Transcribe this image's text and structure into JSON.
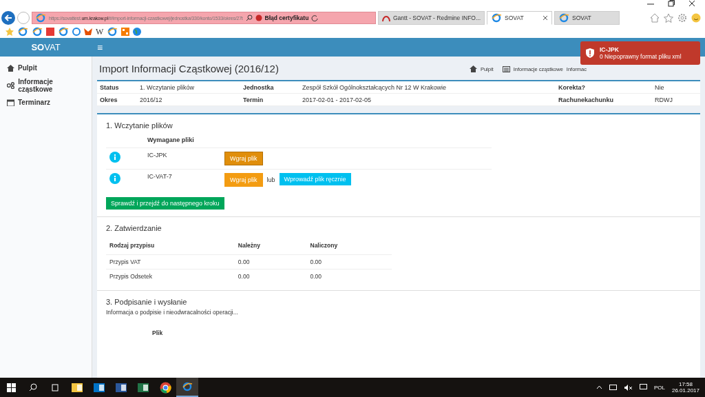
{
  "browser": {
    "url_prefix": "https://sovattest.",
    "url_domain": "um.krakow.pl",
    "url_rest": "/#/import-informacji-czastkowej/jednostka/330/konto/1533/okres/27t",
    "cert_error": "Błąd certyfikatu",
    "fav_letter": "W",
    "tabs": [
      {
        "title": "Gantt - SOVAT - Redmine INFO...",
        "selected": false
      },
      {
        "title": "SOVAT",
        "selected": true
      },
      {
        "title": "SOVAT",
        "selected": false
      }
    ]
  },
  "app": {
    "logo_bold": "SO",
    "logo_rest": "VAT",
    "menu_glyph": "≡"
  },
  "sidebar": {
    "items": [
      {
        "label": "Pulpit"
      },
      {
        "label": "Informacje cząstkowe"
      },
      {
        "label": "Terminarz"
      }
    ]
  },
  "page": {
    "title": "Import Informacji Cząstkowej (2016/12)",
    "breadcrumb": [
      "Pulpit",
      "Informacje cząstkowe",
      "Informac"
    ],
    "info": [
      [
        {
          "label": "Status",
          "value": "1. Wczytanie plików"
        },
        {
          "label": "Jednostka",
          "value": "Zespół Szkół Ogólnokształcących Nr 12 W Krakowie"
        },
        {
          "label": "Korekta?",
          "value": "Nie"
        }
      ],
      [
        {
          "label": "Okres",
          "value": "2016/12"
        },
        {
          "label": "Termin",
          "value": "2017-02-01 - 2017-02-05"
        },
        {
          "label": "Rachunekachunku",
          "value": "RDWJ"
        }
      ]
    ]
  },
  "step1": {
    "title": "1. Wczytanie plików",
    "header": "Wymagane pliki",
    "files": [
      {
        "name": "IC-JPK",
        "upload": "Wgraj plik",
        "focused": true
      },
      {
        "name": "IC-VAT-7",
        "upload": "Wgraj plik",
        "focused": false,
        "or": "lub",
        "manual": "Wprowadź plik ręcznie"
      }
    ],
    "next": "Sprawdź i przejdź do następnego kroku"
  },
  "step2": {
    "title": "2. Zatwierdzanie",
    "columns": [
      "Rodzaj przypisu",
      "Należny",
      "Naliczony"
    ],
    "rows": [
      [
        "Przypis VAT",
        "0.00",
        "0.00"
      ],
      [
        "Przypis Odsetek",
        "0.00",
        "0.00"
      ]
    ]
  },
  "step3": {
    "title": "3. Podpisanie i wysłanie",
    "note": "Informacja o podpisie i nieodwracalności operacji...",
    "column": "Plik"
  },
  "toast": {
    "title": "IC-JPK",
    "message": "0 Niepoprawny format pliku xml"
  },
  "taskbar": {
    "apps": [
      {
        "kind": "explorer",
        "selected": false
      },
      {
        "kind": "outlook",
        "selected": false
      },
      {
        "kind": "word",
        "selected": false
      },
      {
        "kind": "excel",
        "selected": false
      },
      {
        "kind": "chrome",
        "selected": false
      },
      {
        "kind": "ie",
        "selected": true
      }
    ],
    "language": "POL",
    "time": "17:58",
    "date": "26.01.2017"
  }
}
